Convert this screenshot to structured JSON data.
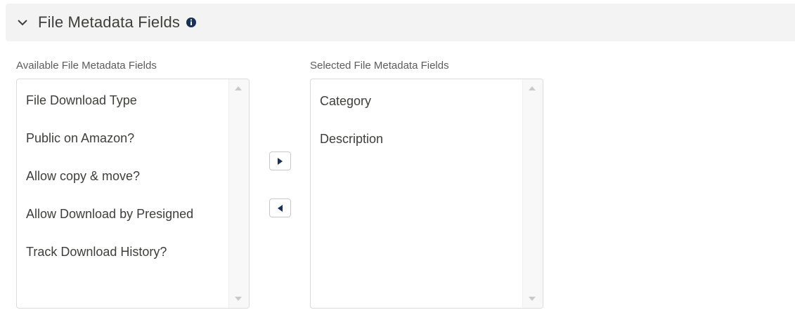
{
  "section": {
    "title": "File Metadata Fields",
    "chevron_icon": "chevron-down-icon",
    "info_icon": "info-icon",
    "info_icon_color": "#16325c"
  },
  "available": {
    "label": "Available File Metadata Fields",
    "items": [
      "File Download Type",
      "Public on Amazon?",
      "Allow copy & move?",
      "Allow Download by Presigned",
      "Track Download History?"
    ]
  },
  "selected": {
    "label": "Selected File Metadata Fields",
    "items": [
      "Category",
      "Description"
    ]
  },
  "buttons": {
    "move_right_icon": "triangle-right-icon",
    "move_left_icon": "triangle-left-icon"
  }
}
